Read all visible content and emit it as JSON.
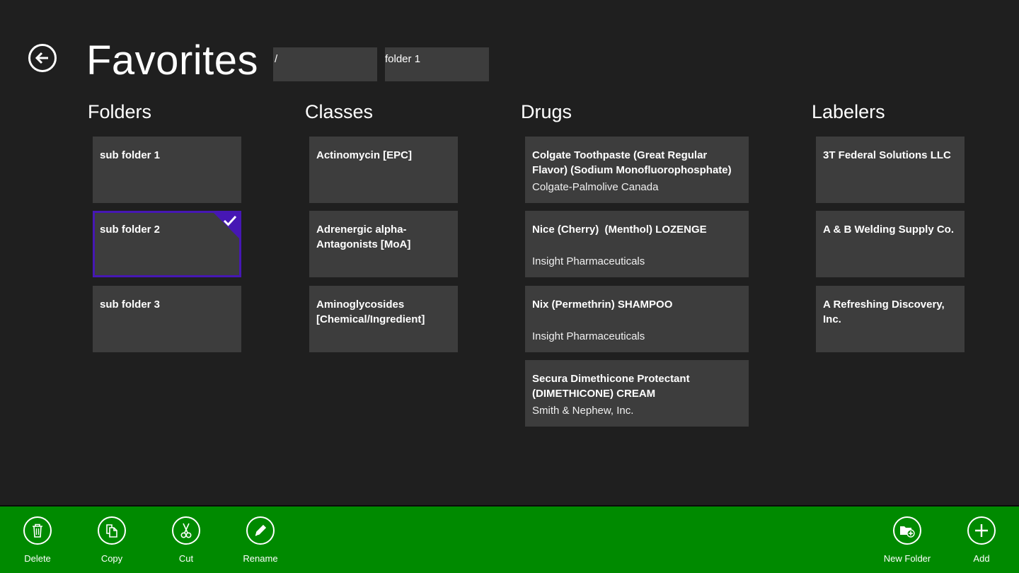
{
  "header": {
    "title": "Favorites",
    "breadcrumb": [
      "/",
      "folder 1"
    ]
  },
  "sections": {
    "folders": {
      "title": "Folders",
      "items": [
        {
          "title": "sub folder 1"
        },
        {
          "title": "sub folder 2",
          "selected": true
        },
        {
          "title": "sub folder 3"
        }
      ]
    },
    "classes": {
      "title": "Classes",
      "items": [
        {
          "title": "Actinomycin [EPC]"
        },
        {
          "title": "Adrenergic alpha-Antagonists [MoA]"
        },
        {
          "title": "Aminoglycosides [Chemical/Ingredient]"
        }
      ]
    },
    "drugs": {
      "title": "Drugs",
      "items": [
        {
          "title": "Colgate Toothpaste (Great Regular Flavor) (Sodium Monofluorophosphate) PASTE,...",
          "labeler": "Colgate-Palmolive Canada"
        },
        {
          "title": "Nice (Cherry)  (Menthol) LOZENGE",
          "labeler": "Insight Pharmaceuticals"
        },
        {
          "title": "Nix (Permethrin) SHAMPOO",
          "labeler": "Insight Pharmaceuticals"
        },
        {
          "title": "Secura Dimethicone Protectant (DIMETHICONE) CREAM",
          "labeler": "Smith & Nephew, Inc."
        }
      ]
    },
    "labelers": {
      "title": "Labelers",
      "items": [
        {
          "title": "3T Federal Solutions LLC"
        },
        {
          "title": "A & B Welding Supply Co."
        },
        {
          "title": "A Refreshing Discovery, Inc."
        }
      ]
    }
  },
  "app_bar": {
    "left": [
      {
        "label": "Delete",
        "icon": "trash-icon"
      },
      {
        "label": "Copy",
        "icon": "copy-icon"
      },
      {
        "label": "Cut",
        "icon": "scissors-icon"
      },
      {
        "label": "Rename",
        "icon": "pencil-icon"
      }
    ],
    "right": [
      {
        "label": "New Folder",
        "icon": "new-folder-icon"
      },
      {
        "label": "Add",
        "icon": "plus-icon"
      }
    ]
  },
  "colors": {
    "background": "#1f1f1f",
    "tile": "#3d3d3d",
    "selection": "#4617b4",
    "app_bar": "#008a00"
  }
}
